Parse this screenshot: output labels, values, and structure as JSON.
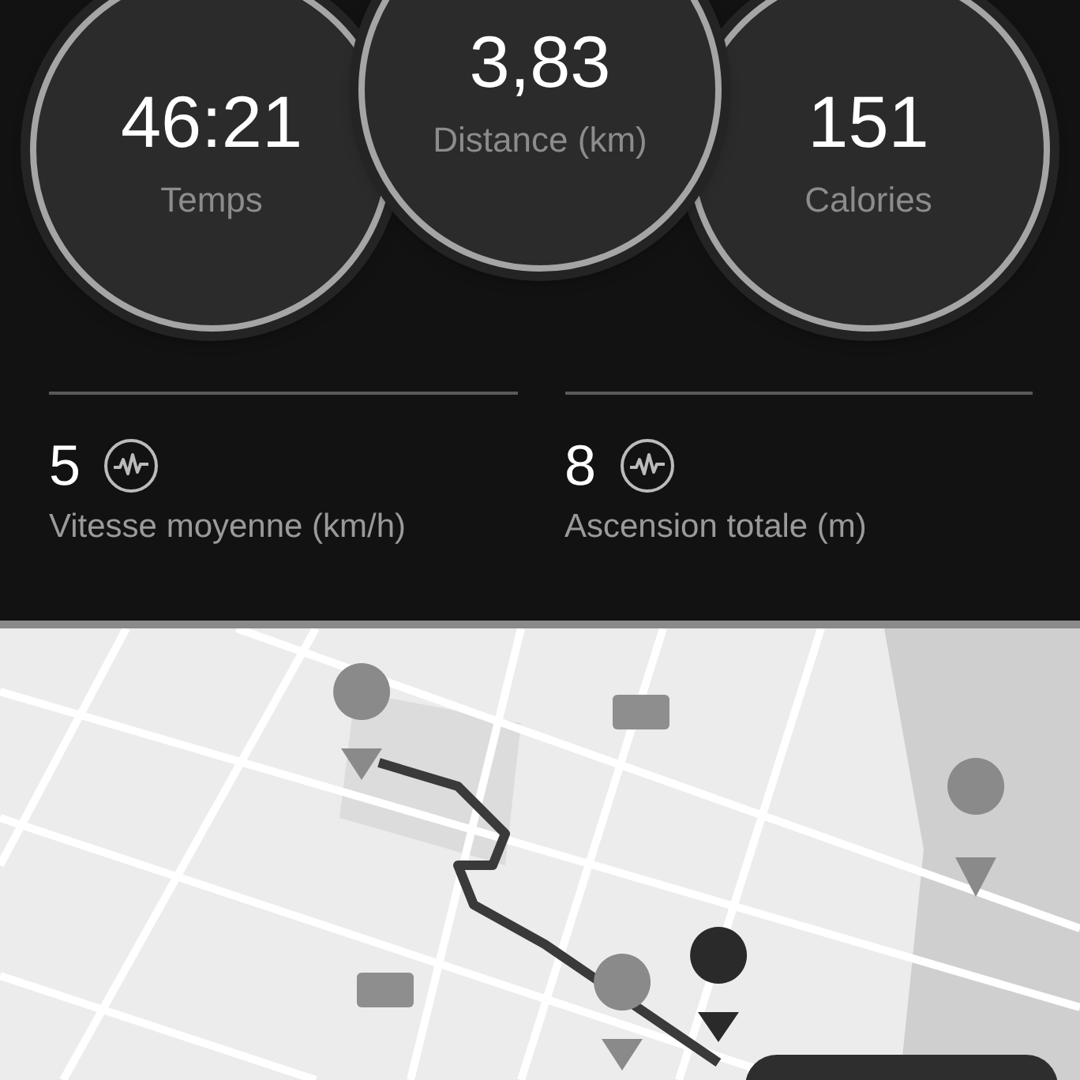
{
  "summary_dials": [
    {
      "value": "46:21",
      "label": "Temps",
      "raised": false
    },
    {
      "value": "3,83",
      "label": "Distance (km)",
      "raised": true
    },
    {
      "value": "151",
      "label": "Calories",
      "raised": false
    }
  ],
  "metrics": [
    {
      "value": "5",
      "label": "Vitesse moyenne (km/h)"
    },
    {
      "value": "8",
      "label": "Ascension totale (m)"
    }
  ]
}
